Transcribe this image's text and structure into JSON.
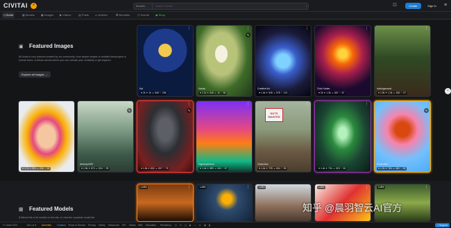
{
  "header": {
    "logo": "CIVITAI",
    "coin": "⚡",
    "search_scope": "Models",
    "search_placeholder": "Search Civitai",
    "search_shortcut": "/",
    "create_label": "Create",
    "signin_label": "Sign In"
  },
  "nav": {
    "items": [
      {
        "icon": "⌂",
        "label": "Home"
      },
      {
        "icon": "▦",
        "label": "Models"
      },
      {
        "icon": "▣",
        "label": "Images"
      },
      {
        "icon": "▶",
        "label": "Videos"
      },
      {
        "icon": "▤",
        "label": "Posts"
      },
      {
        "icon": "▭",
        "label": "Articles"
      },
      {
        "icon": "✪",
        "label": "Bounties"
      },
      {
        "icon": "◷",
        "label": "Events"
      },
      {
        "icon": "◉",
        "label": "Shop"
      }
    ]
  },
  "featured_images": {
    "title": "Featured Images",
    "description": "All kinds of cool pictures created by our community, from simple shapes to detailed landscapes or human faces. A virtual canvas where you can unleash your creativity or get inspired.",
    "button": "Explore all images",
    "cards": [
      {
        "author": "Kai",
        "stats": "♥ 2k ✦ 1k ☺ 845 ♡ 236"
      },
      {
        "author": "Kakaa",
        "stats": "♥ 1.1k ✦ 648 ☺ 1k ♡ 86"
      },
      {
        "author": "Creative Art",
        "stats": "♥ 1.4k ✦ 945 ☺ 578 ♡ 113"
      },
      {
        "author": "Civic Hunter",
        "stats": "♥ 2k ✦ 1.3k ☺ 567 ♡ 87"
      },
      {
        "author": "lookingaround",
        "stats": "♥ 1.9k ✦ 1.3k ☺ 652 ♡ 97"
      },
      {
        "author": "",
        "stats": "♥ 1.7k ✦ 993 ☺ 608 ♡ 85"
      },
      {
        "author": "dreamy1005",
        "stats": "♥ 1.5k ✦ 874 ☺ 534 ♡ 99"
      },
      {
        "author": "",
        "stats": "♥ 1.5k ✦ 832 ☺ 507 ♡ 75"
      },
      {
        "author": "Hyperspectrum",
        "stats": "♥ 1.4k ✦ 889 ☺ 543 ♡ 87"
      },
      {
        "author": "Chanchan",
        "stats": "♥ 1.4k ✦ 799 ☺ 604 ♡ 95",
        "sign": "NUTS WANTED"
      },
      {
        "author": "",
        "stats": "♥ 1.4k ✦ 794 ☺ 523 ♡ 81"
      },
      {
        "author": "Productive",
        "stats": "♥ 1.2k ✦ 784 ☺ 480 ♡ 86"
      }
    ]
  },
  "featured_models": {
    "title": "Featured Models",
    "description": "A filtered list of all models on the site, to view the complete model list",
    "cards": [
      {
        "label": "LoRA"
      },
      {
        "label": "LoRA"
      },
      {
        "label": "LoRA"
      },
      {
        "label": "LoRA"
      },
      {
        "label": "LoRA"
      }
    ]
  },
  "footer": {
    "items": [
      "© Civitai 2024",
      "Join Us ♥",
      "Advertise",
      "Creators",
      "Terms of Service",
      "Privacy",
      "Safety",
      "Newsroom",
      "API",
      "Status",
      "Wiki",
      "Education",
      "Residency"
    ],
    "support": "? Support"
  },
  "watermark": "知乎 @晨羽智云AI官方"
}
